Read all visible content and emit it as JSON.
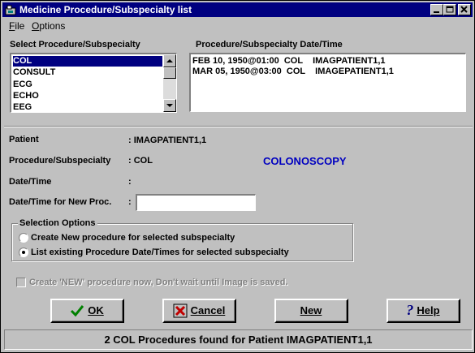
{
  "window": {
    "title": "Medicine Procedure/Subspecialty list"
  },
  "menu": {
    "file": "File",
    "options": "Options"
  },
  "procedure_list": {
    "label": "Select Procedure/Subspecialty",
    "items": [
      "COL",
      "CONSULT",
      "ECG",
      "ECHO",
      "EEG"
    ],
    "selected_index": 0
  },
  "datetime_list": {
    "label": "Procedure/Subspecialty Date/Time",
    "items": [
      "FEB 10, 1950@01:00  COL    IMAGPATIENT1,1",
      "MAR 05, 1950@03:00  COL    IMAGEPATIENT1,1"
    ]
  },
  "info": {
    "patient_label": "Patient",
    "patient_value": ": IMAGPATIENT1,1",
    "procedure_label": "Procedure/Subspecialty",
    "procedure_value": ": COL",
    "procedure_name": "COLONOSCOPY",
    "datetime_label": "Date/Time",
    "datetime_value": ":",
    "new_proc_label": "Date/Time for New Proc.",
    "new_proc_colon": ":",
    "new_proc_value": ""
  },
  "selection_options": {
    "label": "Selection Options",
    "option_create": "Create New procedure for selected subspecialty",
    "option_list": "List existing Procedure Date/Times for selected subspecialty",
    "selected": "list"
  },
  "create_now_checkbox": {
    "label": "Create 'NEW' procedure now, Don't wait until Image is saved.",
    "checked": false,
    "enabled": false
  },
  "buttons": {
    "ok": "OK",
    "cancel": "Cancel",
    "new": "New",
    "help": "Help"
  },
  "status": "2 COL Procedures found for Patient  IMAGPATIENT1,1",
  "colors": {
    "titlebar": "#000080",
    "accent_text": "#0000c0",
    "selection": "#000080",
    "ok_check": "#008000",
    "cancel_x": "#c00000",
    "help_q": "#000080"
  }
}
